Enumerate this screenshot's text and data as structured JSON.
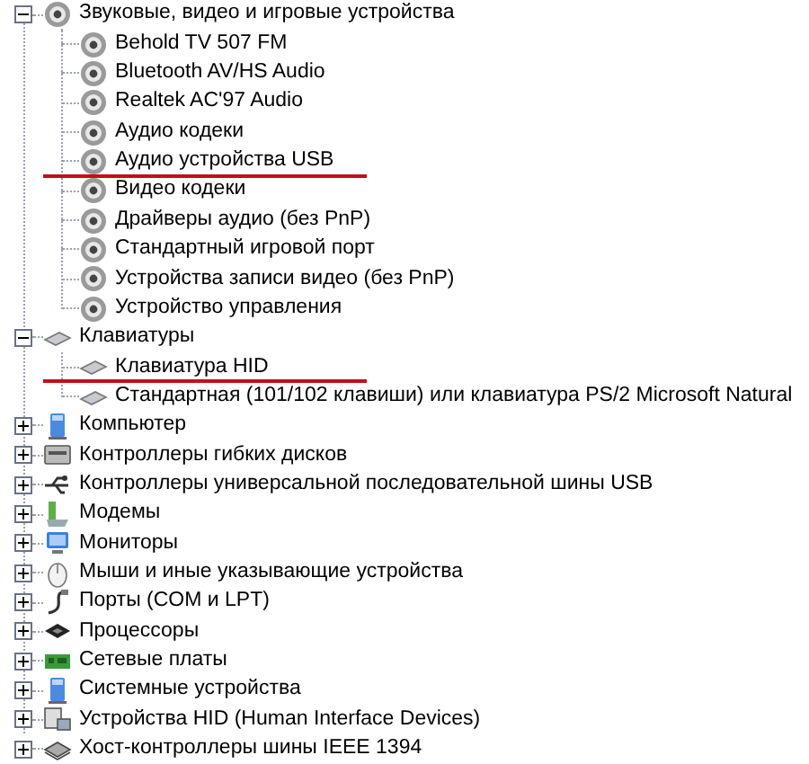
{
  "tree": [
    {
      "label": "Звуковые, видео и игровые устройства",
      "kind": "speaker",
      "expanded": true,
      "children": [
        {
          "label": "Behold TV 507 FM",
          "kind": "speaker",
          "underlined": false
        },
        {
          "label": "Bluetooth AV/HS Audio",
          "kind": "speaker",
          "underlined": false
        },
        {
          "label": "Realtek AC'97 Audio",
          "kind": "speaker",
          "underlined": false
        },
        {
          "label": "Аудио кодеки",
          "kind": "speaker",
          "underlined": false
        },
        {
          "label": "Аудио устройства USB",
          "kind": "speaker",
          "underlined": true
        },
        {
          "label": "Видео кодеки",
          "kind": "speaker",
          "underlined": false
        },
        {
          "label": "Драйверы аудио (без PnP)",
          "kind": "speaker",
          "underlined": false
        },
        {
          "label": "Стандартный игровой порт",
          "kind": "speaker",
          "underlined": false
        },
        {
          "label": "Устройства записи видео (без PnP)",
          "kind": "speaker",
          "underlined": false
        },
        {
          "label": "Устройство управления",
          "kind": "speaker",
          "underlined": false
        }
      ]
    },
    {
      "label": "Клавиатуры",
      "kind": "keyboard",
      "expanded": true,
      "children": [
        {
          "label": "Клавиатура HID",
          "kind": "keyboard",
          "underlined": true
        },
        {
          "label": "Стандартная (101/102 клавиши) или клавиатура PS/2 Microsoft Natural",
          "kind": "keyboard",
          "underlined": false
        }
      ]
    },
    {
      "label": "Компьютер",
      "kind": "computer",
      "expanded": false
    },
    {
      "label": "Контроллеры гибких дисков",
      "kind": "floppy",
      "expanded": false
    },
    {
      "label": "Контроллеры универсальной последовательной шины USB",
      "kind": "usb",
      "expanded": false
    },
    {
      "label": "Модемы",
      "kind": "modem",
      "expanded": false
    },
    {
      "label": "Мониторы",
      "kind": "monitor",
      "expanded": false
    },
    {
      "label": "Мыши и иные указывающие устройства",
      "kind": "mouse",
      "expanded": false
    },
    {
      "label": "Порты (COM и LPT)",
      "kind": "port",
      "expanded": false
    },
    {
      "label": "Процессоры",
      "kind": "cpu",
      "expanded": false
    },
    {
      "label": "Сетевые платы",
      "kind": "network",
      "expanded": false
    },
    {
      "label": "Системные устройства",
      "kind": "computer",
      "expanded": false
    },
    {
      "label": "Устройства HID (Human Interface Devices)",
      "kind": "hid",
      "expanded": false
    },
    {
      "label": "Хост-контроллеры шины IEEE 1394",
      "kind": "firewire",
      "expanded": false
    }
  ]
}
